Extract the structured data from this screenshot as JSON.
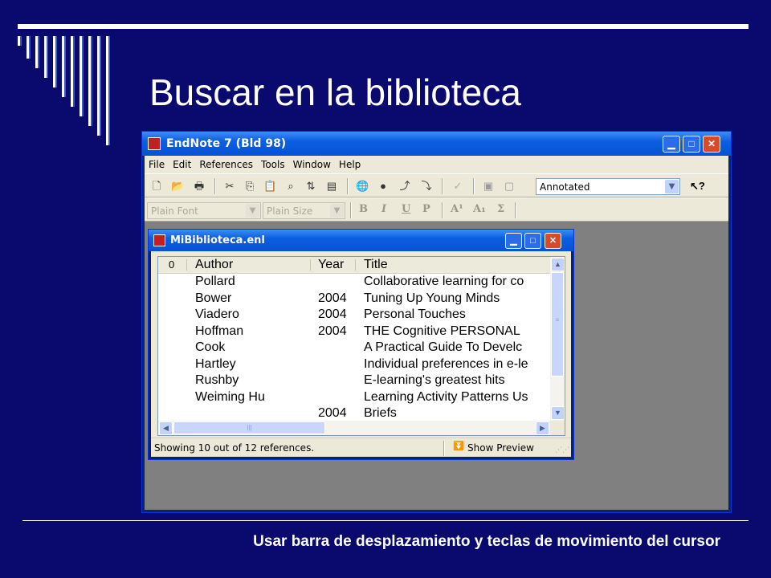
{
  "slide": {
    "title": "Buscar en la biblioteca",
    "caption": "Usar barra de desplazamiento y teclas de movimiento del cursor"
  },
  "app": {
    "title": "EndNote 7 (Bld 98)",
    "menu": [
      "File",
      "Edit",
      "References",
      "Tools",
      "Window",
      "Help"
    ],
    "style_select": "Annotated",
    "font_select": "Plain Font",
    "size_select": "Plain Size",
    "format_buttons": [
      "B",
      "I",
      "U",
      "P",
      "A¹",
      "A₁",
      "Σ"
    ],
    "icons": {
      "new": "new-document-icon",
      "open": "open-folder-icon",
      "print": "print-icon",
      "cut": "cut-icon",
      "copy": "copy-icon",
      "paste": "paste-icon",
      "find": "binoculars-icon",
      "sort": "sort-az-icon",
      "stack": "stack-icon",
      "web": "globe-icon",
      "online": "online-search-icon",
      "insert": "insert-citation-icon",
      "goto": "go-to-word-icon",
      "spell": "spell-check-icon",
      "image": "image-icon",
      "figure": "figure-icon",
      "help": "whats-this-help-icon"
    }
  },
  "library": {
    "title": "MiBiblioteca.enl",
    "columns": {
      "attach": "0",
      "author": "Author",
      "year": "Year",
      "title": "Title"
    },
    "rows": [
      {
        "author": "Pollard",
        "year": "",
        "title": "Collaborative learning for co"
      },
      {
        "author": "Bower",
        "year": "2004",
        "title": "Tuning Up Young Minds"
      },
      {
        "author": "Viadero",
        "year": "2004",
        "title": "Personal Touches"
      },
      {
        "author": "Hoffman",
        "year": "2004",
        "title": "THE Cognitive PERSONAL"
      },
      {
        "author": "Cook",
        "year": "",
        "title": "A Practical Guide To Develc"
      },
      {
        "author": "Hartley",
        "year": "",
        "title": "Individual preferences in e-le"
      },
      {
        "author": "Rushby",
        "year": "",
        "title": "E-learning's greatest hits"
      },
      {
        "author": "Weiming Hu",
        "year": "",
        "title": "Learning Activity Patterns Us"
      },
      {
        "author": "",
        "year": "2004",
        "title": "Briefs"
      }
    ],
    "status": "Showing 10 out of 12 references.",
    "preview_button": "Show Preview"
  }
}
